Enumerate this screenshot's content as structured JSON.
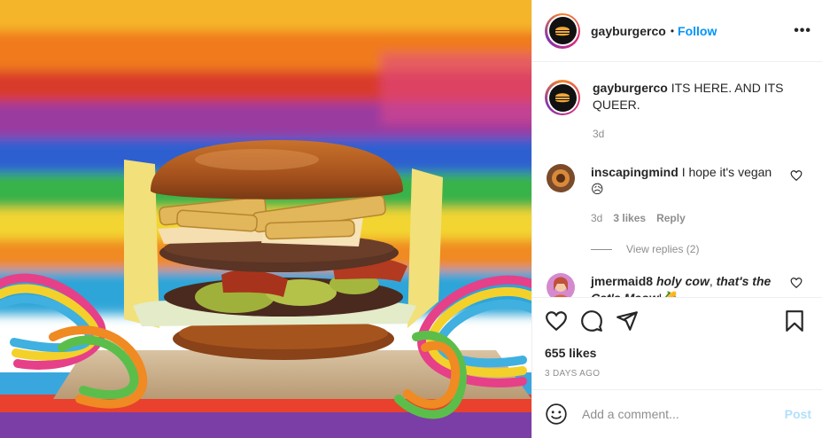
{
  "post": {
    "username": "gayburgerco",
    "dot": "•",
    "follow_label": "Follow",
    "more_label": "•••",
    "caption_text": "ITS HERE. AND ITS QUEER.",
    "caption_age": "3d"
  },
  "comments": [
    {
      "username": "inscapingmind",
      "text": "I hope it's vegan",
      "emoji": "😥",
      "age": "3d",
      "likes": "3 likes",
      "reply_label": "Reply",
      "view_replies": "View replies (2)"
    },
    {
      "username": "jmermaid8",
      "text_part1": "holy cow",
      "text_part2": ", ",
      "text_part3": "that's the Cat's Meow",
      "text_part4": "!",
      "emoji": "🌽"
    }
  ],
  "actions": {
    "likes": "655 likes",
    "time_ago": "3 DAYS AGO",
    "icons": [
      "heart-icon",
      "comment-icon",
      "share-icon",
      "bookmark-icon"
    ]
  },
  "add_comment": {
    "placeholder": "Add a comment...",
    "post_label": "Post",
    "emoji_icon": "smiley-icon"
  },
  "colors": {
    "link": "#0095f6",
    "muted": "#8e8e8e",
    "post_disabled": "#b2dffc"
  }
}
